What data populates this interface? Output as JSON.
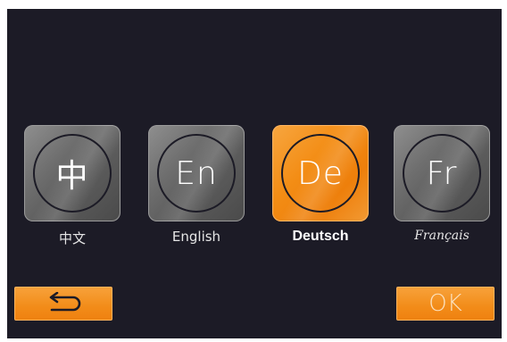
{
  "languages": [
    {
      "code": "中",
      "label": "中文",
      "selected": false
    },
    {
      "code": "En",
      "label": "English",
      "selected": false
    },
    {
      "code": "De",
      "label": "Deutsch",
      "selected": true
    },
    {
      "code": "Fr",
      "label": "Français",
      "selected": false
    }
  ],
  "buttons": {
    "back_icon": "return-arrow-icon",
    "ok_label": "OK"
  },
  "colors": {
    "background": "#1c1b26",
    "accent": "#f28c19",
    "tile_gray": "#6e6e6e"
  }
}
